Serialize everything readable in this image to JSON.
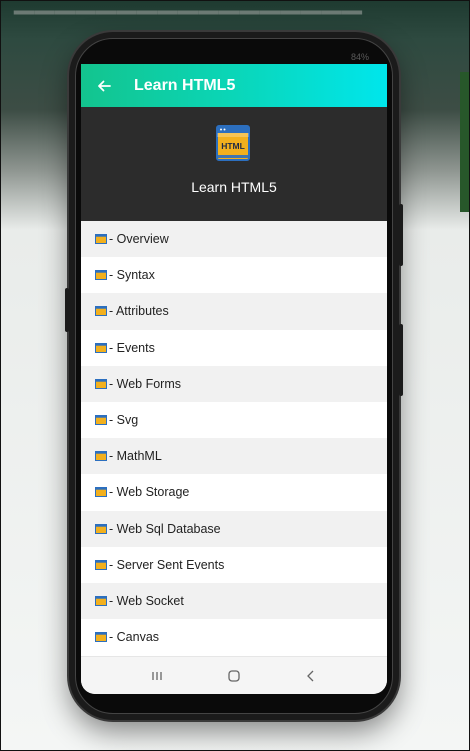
{
  "app": {
    "appbar_title": "Learn HTML5",
    "header_title": "Learn HTML5",
    "logo_text": "HTML",
    "status_text": "84%"
  },
  "list": {
    "items": [
      "- Overview",
      "- Syntax",
      "- Attributes",
      "- Events",
      "- Web Forms",
      "- Svg",
      "- MathML",
      "- Web Storage",
      "- Web Sql Database",
      "- Server Sent Events",
      "- Web Socket",
      "- Canvas"
    ]
  },
  "colors": {
    "appbar_start": "#13c48e",
    "appbar_end": "#00e6ec",
    "header_bg": "#2c2c2c",
    "logo_yellow": "#f2b01e",
    "logo_blue": "#2c6fbf"
  },
  "icons": {
    "back": "arrow-left-icon",
    "list": "html-file-icon",
    "nav_recent": "recent-apps-icon",
    "nav_home": "home-icon",
    "nav_back": "chevron-left-icon"
  }
}
